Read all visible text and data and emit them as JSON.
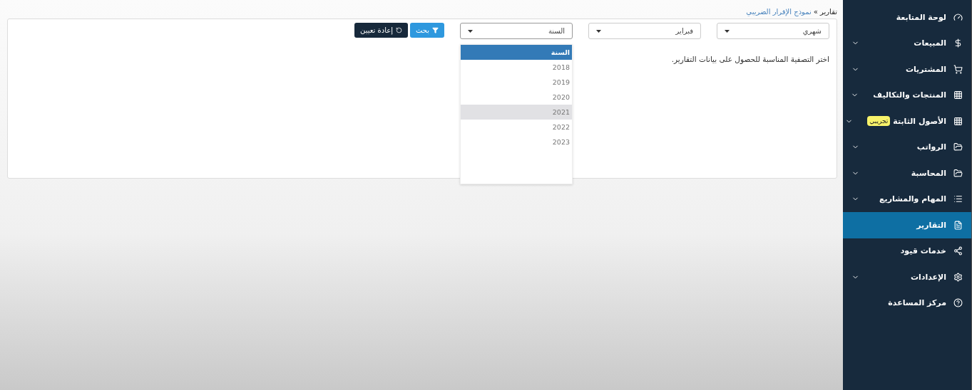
{
  "breadcrumb": {
    "parent": "تقارير",
    "separator": "»",
    "current": "نموذج الإقرار الضريبي"
  },
  "filters": [
    {
      "value": "شهري",
      "open": false
    },
    {
      "value": "فبراير",
      "open": false
    },
    {
      "value": "السنة",
      "open": true
    }
  ],
  "buttons": [
    {
      "label": "بحث",
      "kind": "primary"
    },
    {
      "label": "إعادة تعيين",
      "kind": "dark"
    }
  ],
  "year_dropdown": {
    "options": [
      {
        "label": "السنة",
        "selected": true,
        "hovered": false
      },
      {
        "label": "2018",
        "selected": false,
        "hovered": false
      },
      {
        "label": "2019",
        "selected": false,
        "hovered": false
      },
      {
        "label": "2020",
        "selected": false,
        "hovered": false
      },
      {
        "label": "2021",
        "selected": false,
        "hovered": true
      },
      {
        "label": "2022",
        "selected": false,
        "hovered": false
      },
      {
        "label": "2023",
        "selected": false,
        "hovered": false
      }
    ]
  },
  "message": "اختر التصفية المناسبة للحصول على بيانات التقارير.",
  "sidebar": {
    "items": [
      {
        "label": "لوحة المتابعة",
        "expandable": false,
        "selected": false
      },
      {
        "label": "المبيعات",
        "expandable": true,
        "selected": false
      },
      {
        "label": "المشتريات",
        "expandable": true,
        "selected": false
      },
      {
        "label": "المنتجات والتكاليف",
        "expandable": true,
        "selected": false
      },
      {
        "label": "الأصول الثابتة",
        "badge": "تجريبي",
        "expandable": true,
        "selected": false
      },
      {
        "label": "الرواتب",
        "expandable": true,
        "selected": false
      },
      {
        "label": "المحاسبة",
        "expandable": true,
        "selected": false
      },
      {
        "label": "المهام والمشاريع",
        "expandable": true,
        "selected": false
      },
      {
        "label": "التقارير",
        "expandable": false,
        "selected": true
      },
      {
        "label": "خدمات قيود",
        "expandable": false,
        "selected": false
      },
      {
        "label": "الإعدادات",
        "expandable": true,
        "selected": false
      },
      {
        "label": "مركز المساعدة",
        "expandable": false,
        "selected": false
      }
    ]
  }
}
